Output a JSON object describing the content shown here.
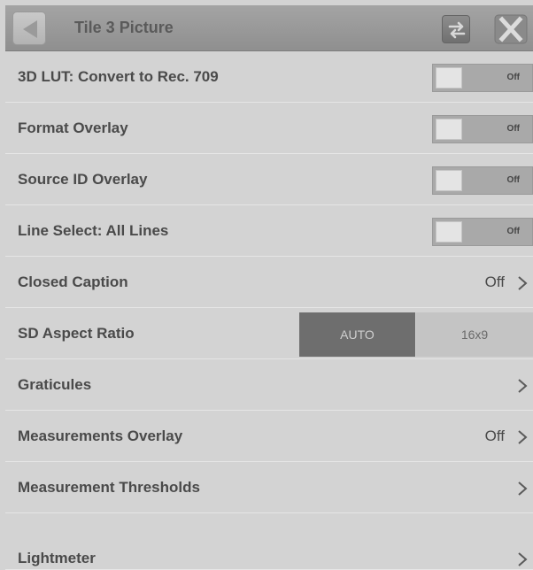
{
  "header": {
    "title": "Tile 3 Picture",
    "back_icon": "back-triangle-icon",
    "swap_icon": "swap-arrows-icon",
    "close_icon": "close-x-icon"
  },
  "rows": [
    {
      "label": "3D LUT: Convert to Rec. 709",
      "control": "toggle",
      "state": "Off"
    },
    {
      "label": "Format Overlay",
      "control": "toggle",
      "state": "Off"
    },
    {
      "label": "Source ID Overlay",
      "control": "toggle",
      "state": "Off"
    },
    {
      "label": "Line Select: All Lines",
      "control": "toggle",
      "state": "Off"
    },
    {
      "label": "Closed Caption",
      "control": "nav",
      "value": "Off"
    },
    {
      "label": "SD Aspect Ratio",
      "control": "segmented",
      "options": [
        "AUTO",
        "16x9"
      ],
      "selected": "AUTO"
    },
    {
      "label": "Graticules",
      "control": "nav",
      "value": ""
    },
    {
      "label": "Measurements Overlay",
      "control": "nav",
      "value": "Off"
    },
    {
      "label": "Measurement Thresholds",
      "control": "nav",
      "value": ""
    },
    {
      "label": "Lightmeter",
      "control": "nav",
      "value": ""
    }
  ],
  "colors": {
    "background": "#d3d3d3",
    "header": "#999999",
    "selected_segment": "#6e6e6e"
  }
}
